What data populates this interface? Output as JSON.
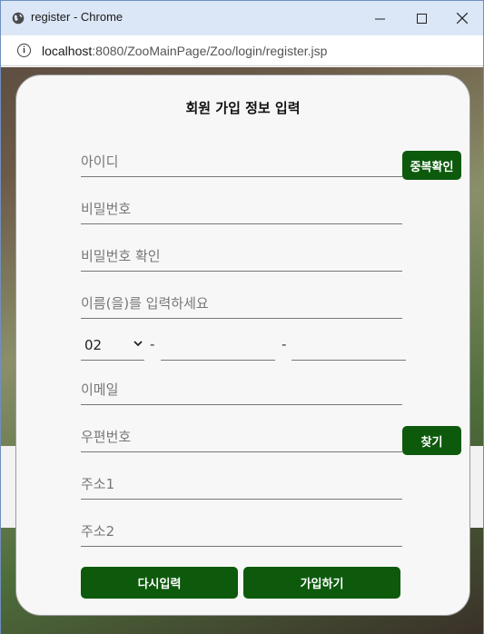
{
  "window": {
    "title": "register - Chrome",
    "url_host": "localhost",
    "url_rest": ":8080/ZooMainPage/Zoo/login/register.jsp"
  },
  "form": {
    "title": "회원 가입 정보 입력",
    "id_placeholder": "아이디",
    "dup_check_label": "중복확인",
    "password_placeholder": "비밀번호",
    "password_confirm_placeholder": "비밀번호 확인",
    "name_placeholder": "이름(을)를 입력하세요",
    "phone_prefix": "02",
    "phone_separator": "-",
    "email_placeholder": "이메일",
    "zipcode_placeholder": "우편번호",
    "find_label": "찾기",
    "address1_placeholder": "주소1",
    "address2_placeholder": "주소2",
    "reset_label": "다시입력",
    "submit_label": "가입하기"
  },
  "colors": {
    "button_green": "#0d5a0d",
    "titlebar": "#dbe6f6"
  }
}
